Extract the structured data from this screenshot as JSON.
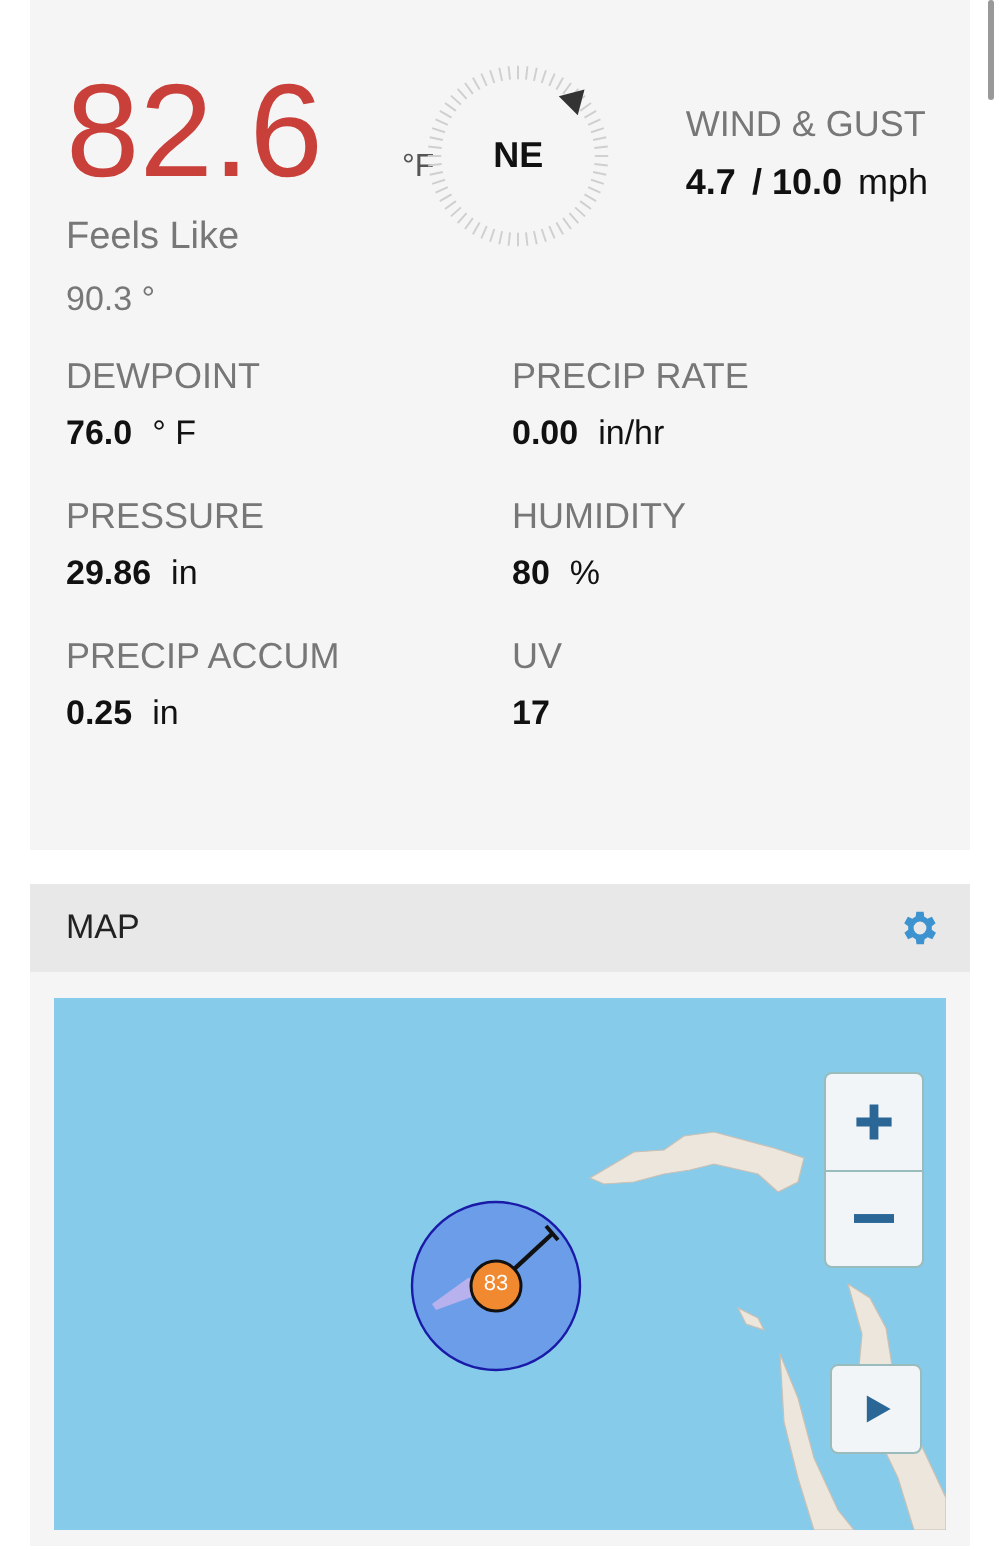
{
  "temperature": {
    "value": "82.6",
    "unit": "°F"
  },
  "feels_like": {
    "label": "Feels Like",
    "value": "90.3 °"
  },
  "compass": {
    "direction": "NE"
  },
  "wind": {
    "label": "WIND & GUST",
    "speed": "4.7",
    "gust": "/ 10.0",
    "unit": "mph"
  },
  "readings": [
    {
      "label": "DEWPOINT",
      "value": "76.0",
      "unit": "° F"
    },
    {
      "label": "PRECIP RATE",
      "value": "0.00",
      "unit": "in/hr"
    },
    {
      "label": "PRESSURE",
      "value": "29.86",
      "unit": "in"
    },
    {
      "label": "HUMIDITY",
      "value": "80",
      "unit": "%"
    },
    {
      "label": "PRECIP ACCUM",
      "value": "0.25",
      "unit": "in"
    },
    {
      "label": "UV",
      "value": "17"
    }
  ],
  "map": {
    "title": "MAP",
    "marker": {
      "label": "83"
    }
  }
}
